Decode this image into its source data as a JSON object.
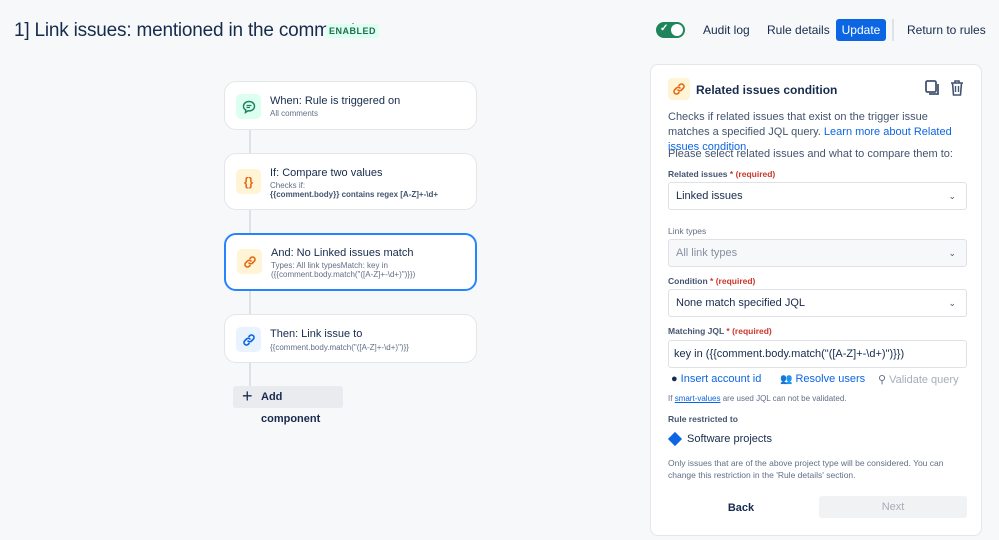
{
  "header": {
    "title": "1] Link issues: mentioned in the comment",
    "status_badge": "ENABLED",
    "toggle_enabled": true,
    "audit_log": "Audit log",
    "rule_details": "Rule details",
    "update": "Update",
    "return_to_rules": "Return to rules"
  },
  "flow": {
    "components": [
      {
        "title": "When: Rule is triggered on",
        "subtitle": "All comments",
        "icon": "comment-icon",
        "color": "#1f845a"
      },
      {
        "title": "If: Compare two values",
        "subtitle_line1": "Checks if:",
        "subtitle_line2": "{{comment.body}} contains regex [A-Z]+-\\d+",
        "icon": "braces-icon",
        "color": "#e56910"
      },
      {
        "title": "And: No Linked issues match",
        "subtitle_line1": "Types: All link typesMatch: key in",
        "subtitle_line2": "({{comment.body.match(\"([A-Z]+-\\d+)\")}})",
        "icon": "link-icon",
        "color": "#e56910",
        "selected": true
      },
      {
        "title": "Then: Link issue to",
        "subtitle": "{{comment.body.match(\"([A-Z]+-\\d+)\")}}",
        "icon": "link-icon",
        "color": "#0c66e4"
      }
    ],
    "add_component": "Add component"
  },
  "panel": {
    "title": "Related issues condition",
    "description": "Checks if related issues that exist on the trigger issue matches a specified JQL query.",
    "learn_more": "Learn more about Related issues condition",
    "prompt": "Please select related issues and what to compare them to:",
    "related_issues_label": "Related issues",
    "required_text": "(required)",
    "related_issues_value": "Linked issues",
    "link_types_label": "Link types",
    "link_types_value": "All link types",
    "condition_label": "Condition",
    "condition_value": "None match specified JQL",
    "matching_jql_label": "Matching JQL",
    "matching_jql_value": "key in ({{comment.body.match(\"([A-Z]+-\\d+)\")}})",
    "insert_account_id": "Insert account id",
    "resolve_users": "Resolve users",
    "validate_query": "Validate query",
    "hint_prefix": "If",
    "hint_link": "smart-values",
    "hint_suffix": "are used JQL can not be validated.",
    "rule_restricted_label": "Rule restricted to",
    "restricted_value": "Software projects",
    "note": "Only issues that are of the above project type will be considered. You can change this restriction in the 'Rule details' section.",
    "back": "Back",
    "next": "Next"
  }
}
